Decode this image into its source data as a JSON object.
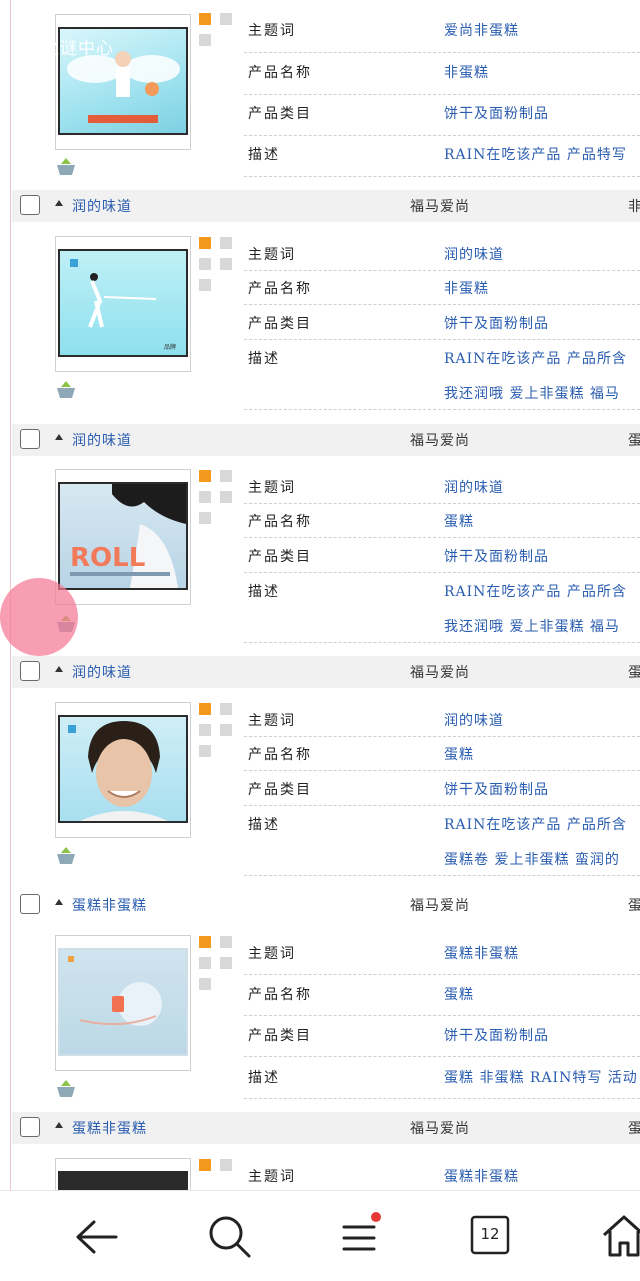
{
  "watermark": "元之谜中心",
  "labels": {
    "keyword": "主题词",
    "product_name": "产品名称",
    "category": "产品类目",
    "description": "描述"
  },
  "first_item": {
    "keyword": "爱尚非蛋糕",
    "product_name": "非蛋糕",
    "category": "饼干及面粉制品",
    "description": "RAIN在吃该产品 产品特写"
  },
  "items": [
    {
      "title": "润的味道",
      "brand": "福马爱尚",
      "extra": "非",
      "keyword": "润的味道",
      "product_name": "非蛋糕",
      "category": "饼干及面粉制品",
      "description": "RAIN在吃该产品 产品所含",
      "description2": "我还润哦 爱上非蛋糕 福马"
    },
    {
      "title": "润的味道",
      "brand": "福马爱尚",
      "extra": "蛋",
      "keyword": "润的味道",
      "product_name": "蛋糕",
      "category": "饼干及面粉制品",
      "description": "RAIN在吃该产品 产品所含",
      "description2": "我还润哦 爱上非蛋糕 福马"
    },
    {
      "title": "润的味道",
      "brand": "福马爱尚",
      "extra": "蛋",
      "keyword": "润的味道",
      "product_name": "蛋糕",
      "category": "饼干及面粉制品",
      "description": "RAIN在吃该产品 产品所含",
      "description2": "蛋糕卷 爱上非蛋糕 蛮润的"
    },
    {
      "title": "蛋糕非蛋糕",
      "brand": "福马爱尚",
      "extra": "蛋",
      "keyword": "蛋糕非蛋糕",
      "product_name": "蛋糕",
      "category": "饼干及面粉制品",
      "description": "蛋糕 非蛋糕 RAIN特写 活动"
    },
    {
      "title": "蛋糕非蛋糕",
      "brand": "福马爱尚",
      "extra": "蛋",
      "keyword": "蛋糕非蛋糕"
    }
  ],
  "nav": {
    "tabs_count": "12"
  },
  "colors": {
    "link": "#2a5db0",
    "orange": "#f39a1e",
    "badge": "#e53935"
  }
}
